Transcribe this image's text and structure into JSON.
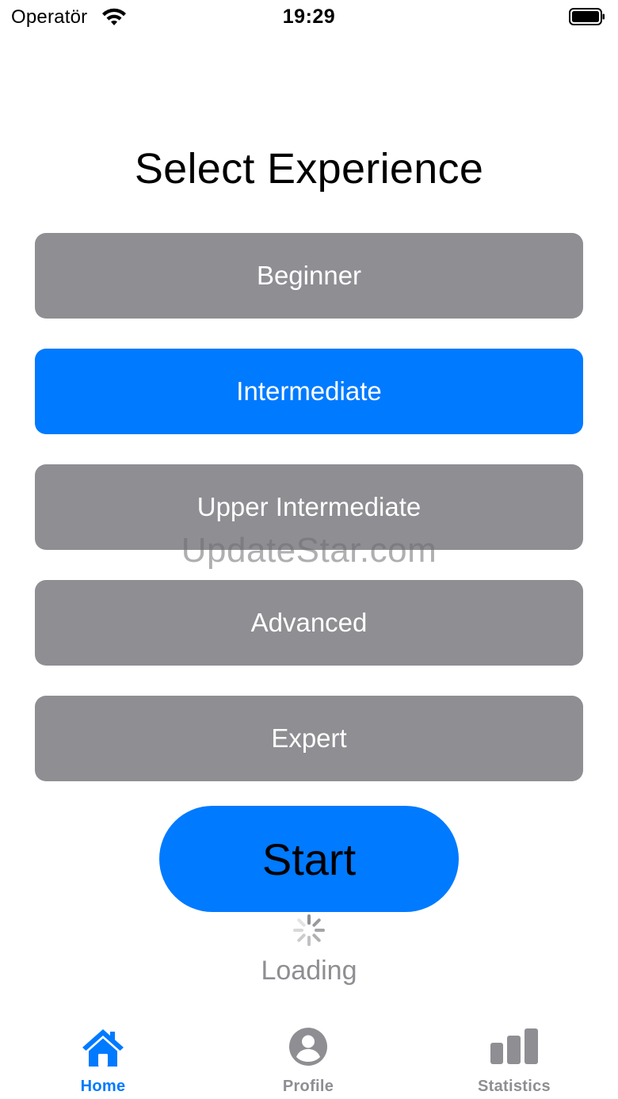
{
  "status_bar": {
    "carrier": "Operatör",
    "time": "19:29",
    "wifi_icon": "wifi-icon",
    "battery_icon": "battery-icon"
  },
  "title": "Select Experience",
  "options": [
    {
      "label": "Beginner",
      "selected": false
    },
    {
      "label": "Intermediate",
      "selected": true
    },
    {
      "label": "Upper Intermediate",
      "selected": false
    },
    {
      "label": "Advanced",
      "selected": false
    },
    {
      "label": "Expert",
      "selected": false
    }
  ],
  "start_label": "Start",
  "loading_label": "Loading",
  "watermark": "UpdateStar.com",
  "tabs": [
    {
      "label": "Home",
      "icon": "house-icon",
      "active": true
    },
    {
      "label": "Profile",
      "icon": "person-circle-icon",
      "active": false
    },
    {
      "label": "Statistics",
      "icon": "chart-bars-icon",
      "active": false
    }
  ],
  "colors": {
    "accent": "#007aff",
    "option_bg": "#8e8e93",
    "inactive": "#8e8e93"
  }
}
